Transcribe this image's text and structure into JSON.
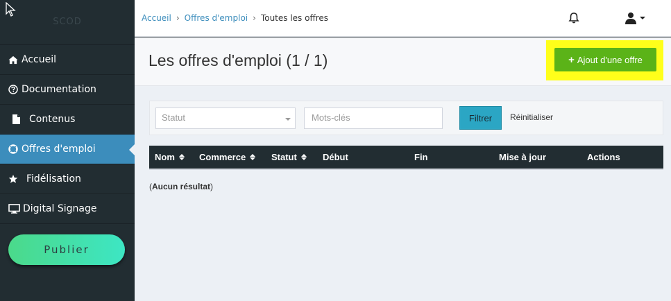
{
  "sidebar": {
    "logo_text": "SCOD",
    "items": [
      {
        "label": "Accueil",
        "icon": "home-icon"
      },
      {
        "label": "Documentation",
        "icon": "question-circle-icon"
      },
      {
        "label": "Contenus",
        "icon": "file-icon"
      },
      {
        "label": "Offres d'emploi",
        "icon": "life-ring-icon",
        "active": true
      },
      {
        "label": "Fidélisation",
        "icon": "star-icon"
      },
      {
        "label": "Digital Signage",
        "icon": "monitor-icon"
      }
    ],
    "publish_label": "Publier"
  },
  "topbar": {
    "breadcrumb": [
      "Accueil",
      "Offres d'emploi",
      "Toutes les offres"
    ],
    "icons": [
      "bell-icon",
      "user-icon",
      "caret-down-icon"
    ]
  },
  "header": {
    "title": "Les offres d'emploi (1 / 1)",
    "add_button": "Ajout d'une offre"
  },
  "filters": {
    "status_placeholder": "Statut",
    "keywords_placeholder": "Mots-clés",
    "filter_button": "Filtrer",
    "reset_link": "Réinitialiser"
  },
  "table": {
    "columns": [
      "Nom",
      "Commerce",
      "Statut",
      "Début",
      "Fin",
      "Mise à jour",
      "Actions"
    ],
    "empty_message": "Aucun résultat"
  },
  "colors": {
    "sidebar_bg": "#222d32",
    "active_item": "#3c8dbc",
    "add_button": "#5bb318",
    "highlight": "#ffff1a",
    "filter_button": "#2ba6c4",
    "link": "#3c8dbc"
  }
}
